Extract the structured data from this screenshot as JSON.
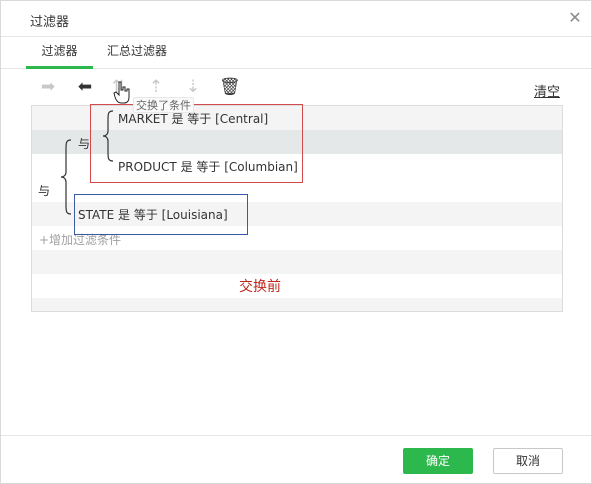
{
  "dialog": {
    "title": "过滤器"
  },
  "tabs": [
    {
      "label": "过滤器",
      "active": true
    },
    {
      "label": "汇总过滤器",
      "active": false
    }
  ],
  "toolbar": {
    "icons": [
      {
        "name": "indent-right-icon",
        "glyph": "➡",
        "enabled": false
      },
      {
        "name": "indent-left-icon",
        "glyph": "⬅",
        "enabled": true
      },
      {
        "name": "swap-conditions-icon",
        "glyph": "⇅",
        "enabled": false
      },
      {
        "name": "move-up-icon",
        "glyph": "⇡",
        "enabled": false
      },
      {
        "name": "move-down-icon",
        "glyph": "⇣",
        "enabled": false
      },
      {
        "name": "delete-icon",
        "glyph": "🗑",
        "enabled": true
      }
    ],
    "clear_label": "清空",
    "tooltip": "交换了条件"
  },
  "filter": {
    "inner_operator": "与",
    "outer_operator": "与",
    "conditions": [
      "MARKET 是 等于 [Central]",
      "PRODUCT 是 等于 [Columbian]",
      "STATE 是 等于 [Louisiana]"
    ],
    "add_label": "+增加过滤条件",
    "annotation": "交换前"
  },
  "colors": {
    "accent": "#2db84d",
    "annotation": "#c0281e",
    "highlight_red": "#d24a4a",
    "highlight_blue": "#3a5aa8"
  },
  "footer": {
    "ok_label": "确定",
    "cancel_label": "取消"
  }
}
